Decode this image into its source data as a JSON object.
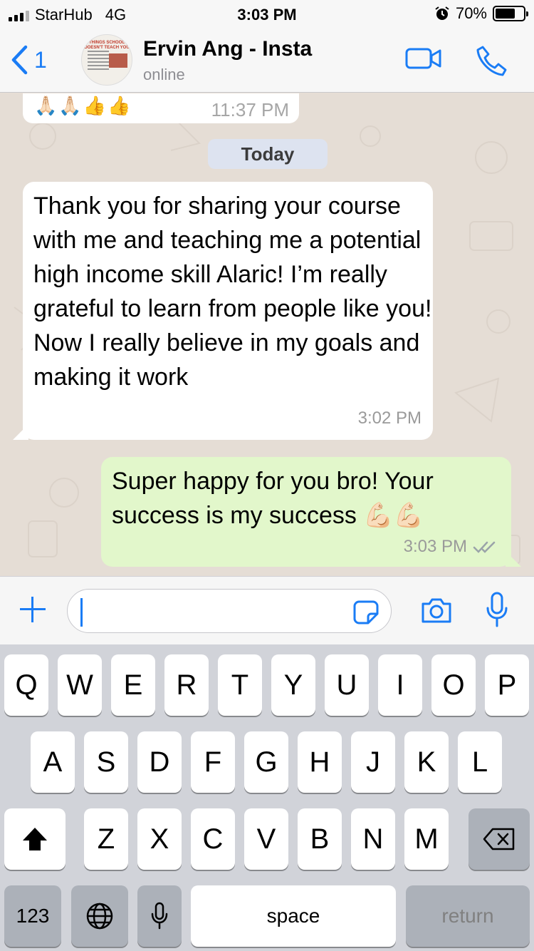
{
  "status_bar": {
    "carrier": "StarHub",
    "network": "4G",
    "time": "3:03 PM",
    "battery": "70%",
    "battery_level": 0.7
  },
  "header": {
    "back_count": "1",
    "contact_name": "Ervin Ang - Insta",
    "contact_status": "online",
    "avatar_caption": "THINGS SCHOOL DOESN'T TEACH YOU"
  },
  "chat": {
    "previous_message": {
      "emoji": "🙏🏻🙏🏻👍👍",
      "time": "11:37 PM"
    },
    "date_separator": "Today",
    "messages": [
      {
        "direction": "incoming",
        "text": "Thank you for sharing your course with me and teaching me a potential high income skill Alaric! I’m really grateful to learn from people like you! Now I really believe in my goals and making it work",
        "time": "3:02 PM"
      },
      {
        "direction": "outgoing",
        "text": "Super happy for you bro! Your success is my success 💪🏻💪🏻",
        "time": "3:03 PM",
        "status": "read"
      }
    ]
  },
  "input": {
    "value": "",
    "placeholder": ""
  },
  "keyboard": {
    "row1": [
      "Q",
      "W",
      "E",
      "R",
      "T",
      "Y",
      "U",
      "I",
      "O",
      "P"
    ],
    "row2": [
      "A",
      "S",
      "D",
      "F",
      "G",
      "H",
      "J",
      "K",
      "L"
    ],
    "row3": [
      "Z",
      "X",
      "C",
      "V",
      "B",
      "N",
      "M"
    ],
    "numbers_key": "123",
    "space_key": "space",
    "return_key": "return"
  },
  "colors": {
    "accent": "#1a7cf5",
    "outgoing_bubble": "#e2f7cb",
    "incoming_bubble": "#ffffff",
    "chat_background": "#e5ddd5",
    "read_ticks": "#9aa3a9"
  },
  "icons": [
    "signal-icon",
    "alarm-icon",
    "battery-icon",
    "back-chevron-icon",
    "video-call-icon",
    "phone-icon",
    "plus-icon",
    "sticker-icon",
    "camera-icon",
    "microphone-icon",
    "shift-icon",
    "delete-icon",
    "globe-icon",
    "dictation-icon",
    "double-check-icon"
  ]
}
